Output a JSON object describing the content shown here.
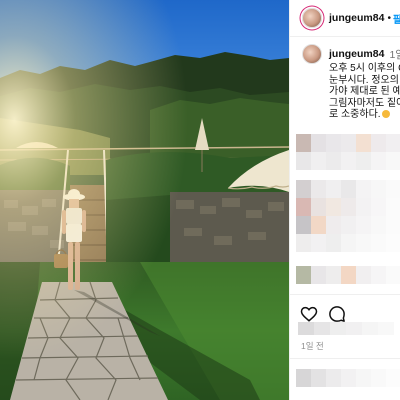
{
  "post": {
    "username": "jungeum84",
    "follow_label": "팔",
    "time_ago_short": "1일",
    "caption_lines": [
      "오후 5시 이후의 C",
      "눈부시다. 정오의",
      "가야 제대로 된 예",
      "그림자마저도 짙어",
      "로 소중하다."
    ],
    "posted_ago": "1일 전"
  },
  "icons": {
    "like": "heart-icon",
    "comment": "comment-bubble-icon",
    "emoji": "sun-emoji"
  },
  "colors": {
    "follow": "#0095f6",
    "story_ring": "#d62976",
    "muted_text": "#737373"
  }
}
